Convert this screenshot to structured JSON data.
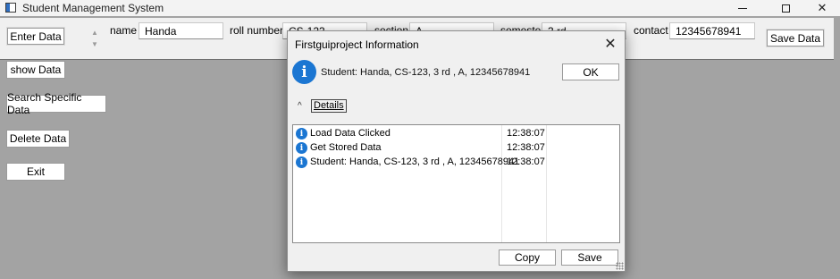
{
  "window": {
    "title": "Student Management System",
    "controls": {
      "minimize": "",
      "maximize": "",
      "close": "✕"
    }
  },
  "topbar": {
    "enter_data_button": "Enter Data",
    "spin_up": "▲",
    "spin_down": "▼",
    "fields": {
      "name": {
        "label": "name",
        "value": "Handa"
      },
      "roll_number": {
        "label": "roll number",
        "value": "CS-123"
      },
      "section": {
        "label": "section",
        "value": "A"
      },
      "semester": {
        "label": "semester",
        "value": "3 rd"
      },
      "contact": {
        "label": "contact",
        "value": "12345678941"
      }
    },
    "save_data_button": "Save Data"
  },
  "sidebar": {
    "buttons": [
      "show Data",
      "Search Specific Data",
      "Delete Data",
      "Exit"
    ]
  },
  "dialog": {
    "title": "Firstguiproject Information",
    "close_glyph": "✕",
    "info_glyph": "i",
    "message": "Student: Handa, CS-123, 3 rd , A, 12345678941",
    "ok_button": "OK",
    "details_chevron": "^",
    "details_label": "Details",
    "log": [
      {
        "message": "Load Data Clicked",
        "time": "12:38:07"
      },
      {
        "message": "Get Stored Data",
        "time": "12:38:07"
      },
      {
        "message": "Student: Handa, CS-123, 3 rd , A, 12345678941",
        "time": "12:38:07"
      }
    ],
    "copy_button": "Copy",
    "save_button": "Save"
  },
  "colors": {
    "background": "#a3a3a3",
    "info_icon": "#1b76d2",
    "panel": "#f0f0f0"
  }
}
